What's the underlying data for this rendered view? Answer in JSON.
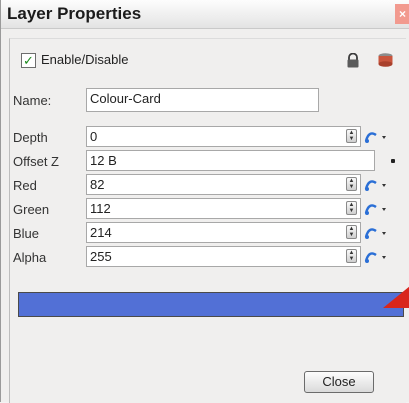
{
  "window": {
    "title": "Layer Properties",
    "close_glyph": "×"
  },
  "enable": {
    "label": "Enable/Disable",
    "checked": true,
    "check_glyph": "✓"
  },
  "name": {
    "label": "Name:",
    "value": "Colour-Card"
  },
  "fields": [
    {
      "label": "Depth",
      "value": "0"
    },
    {
      "label": "Offset Z",
      "value": "12 B"
    },
    {
      "label": "Red",
      "value": "82"
    },
    {
      "label": "Green",
      "value": "112"
    },
    {
      "label": "Blue",
      "value": "214"
    },
    {
      "label": "Alpha",
      "value": "255"
    }
  ],
  "swatch": {
    "color": "#5270d6"
  },
  "buttons": {
    "close": "Close"
  },
  "icons": [
    "lock-icon",
    "layer-icon",
    "function-curve-icon",
    "spinner-icon",
    "dropdown-arrow-icon"
  ]
}
